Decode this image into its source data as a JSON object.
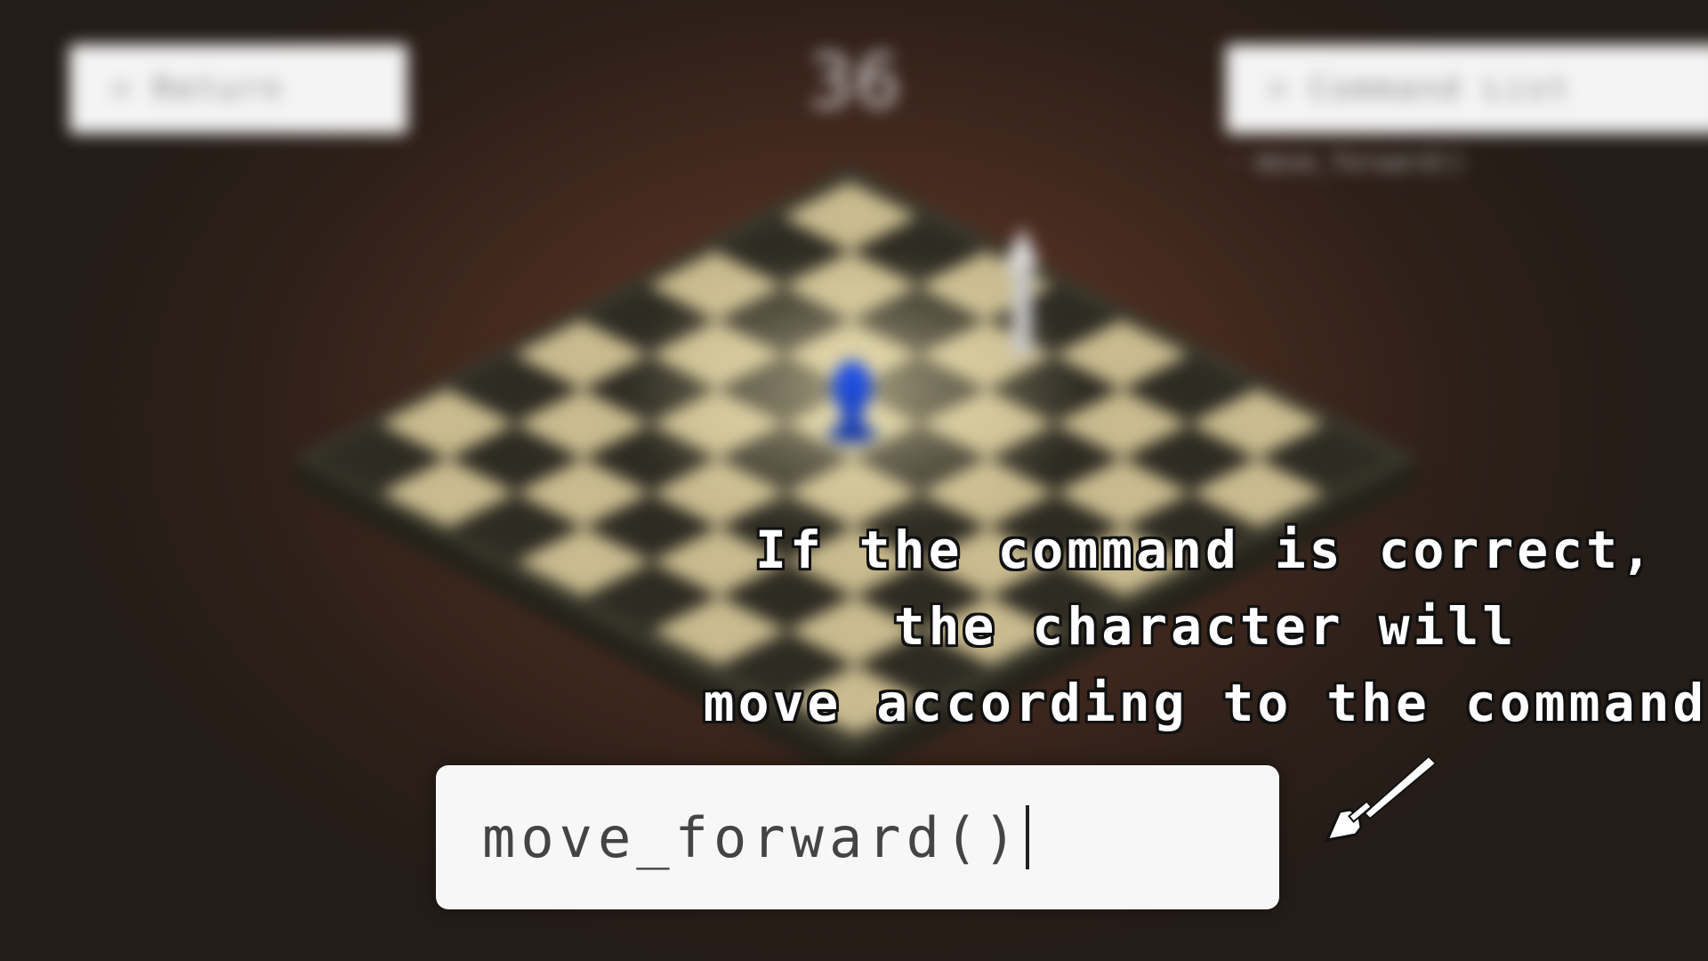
{
  "header": {
    "return_label": "Return",
    "return_icon": "chevron-right-icon",
    "counter": "36",
    "command_list_label": "Command List",
    "command_list_icon": "chevron-right-icon",
    "history": [
      "move_forward()"
    ]
  },
  "overlay": {
    "hint_lines": [
      "If the command is correct,",
      "the character will",
      "move according to the command"
    ]
  },
  "command_input": {
    "value": "move_forward()"
  },
  "pointer": {
    "icon": "pointer-arrow-icon"
  },
  "colors": {
    "player_piece": "#1f4fe0",
    "board_light": "#c9bb8f",
    "board_dark": "#2e2b22",
    "board_frame": "#35342a",
    "background": "#3a2418"
  }
}
